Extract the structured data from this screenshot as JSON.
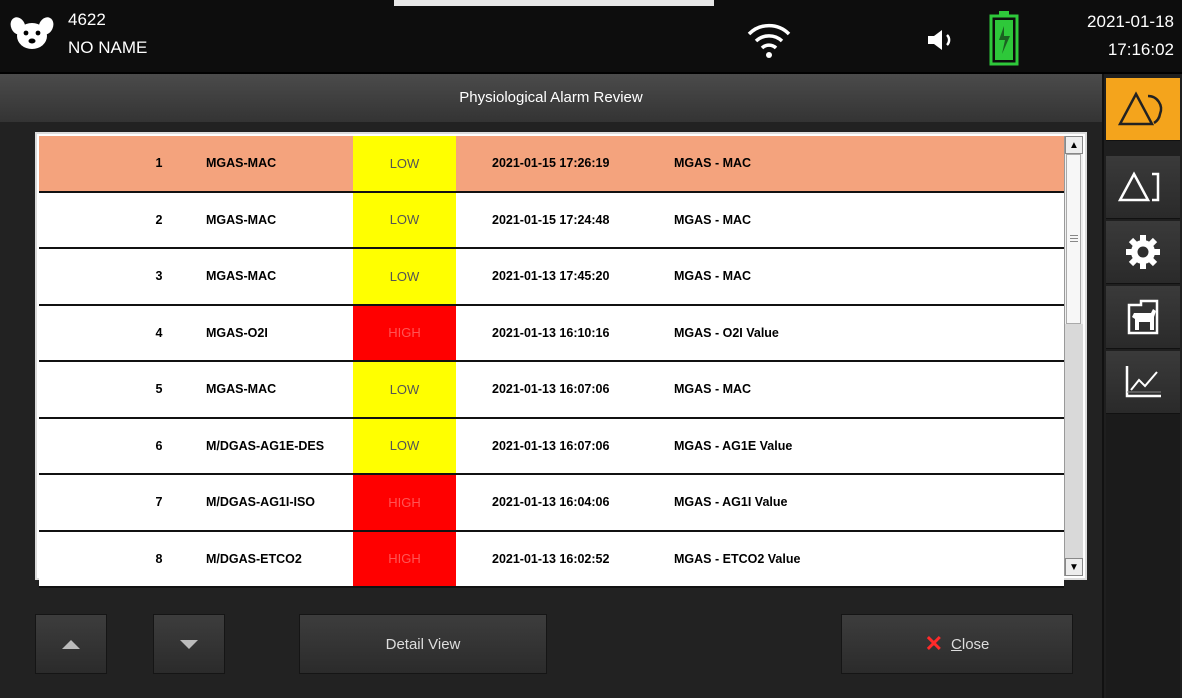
{
  "status_bar": {
    "patient_id": "4622",
    "patient_name": "NO NAME",
    "date": "2021-01-18",
    "time": "17:16:02",
    "icons": [
      "dog-icon",
      "wifi-icon",
      "speaker-icon",
      "battery-icon"
    ]
  },
  "window": {
    "title": "Physiological Alarm Review"
  },
  "alarms": [
    {
      "index": "1",
      "parameter": "MGAS-MAC",
      "level": "LOW",
      "timestamp": "2021-01-15 17:26:19",
      "description": "MGAS - MAC"
    },
    {
      "index": "2",
      "parameter": "MGAS-MAC",
      "level": "LOW",
      "timestamp": "2021-01-15 17:24:48",
      "description": "MGAS - MAC"
    },
    {
      "index": "3",
      "parameter": "MGAS-MAC",
      "level": "LOW",
      "timestamp": "2021-01-13 17:45:20",
      "description": "MGAS - MAC"
    },
    {
      "index": "4",
      "parameter": "MGAS-O2I",
      "level": "HIGH",
      "timestamp": "2021-01-13 16:10:16",
      "description": "MGAS - O2I Value"
    },
    {
      "index": "5",
      "parameter": "MGAS-MAC",
      "level": "LOW",
      "timestamp": "2021-01-13 16:07:06",
      "description": "MGAS - MAC"
    },
    {
      "index": "6",
      "parameter": "M/DGAS-AG1E-DES",
      "level": "LOW",
      "timestamp": "2021-01-13 16:07:06",
      "description": "MGAS - AG1E Value"
    },
    {
      "index": "7",
      "parameter": "M/DGAS-AG1I-ISO",
      "level": "HIGH",
      "timestamp": "2021-01-13 16:04:06",
      "description": "MGAS - AG1I Value"
    },
    {
      "index": "8",
      "parameter": "M/DGAS-ETCO2",
      "level": "HIGH",
      "timestamp": "2021-01-13 16:02:52",
      "description": "MGAS - ETCO2 Value"
    }
  ],
  "selected_row": 1,
  "level_colors": {
    "LOW": "#ffff00",
    "HIGH": "#ff0000",
    "selected_row": "#f4a37d"
  },
  "buttons": {
    "detail_view": "Detail View",
    "close_mnemonic": "C",
    "close_rest": "lose"
  },
  "sidebar": {
    "items": [
      "alarm-review-icon",
      "alarm-settings-icon",
      "gear-icon",
      "patient-icon",
      "trend-icon"
    ],
    "active": "alarm-review-icon",
    "accent": "#f4a41c"
  }
}
